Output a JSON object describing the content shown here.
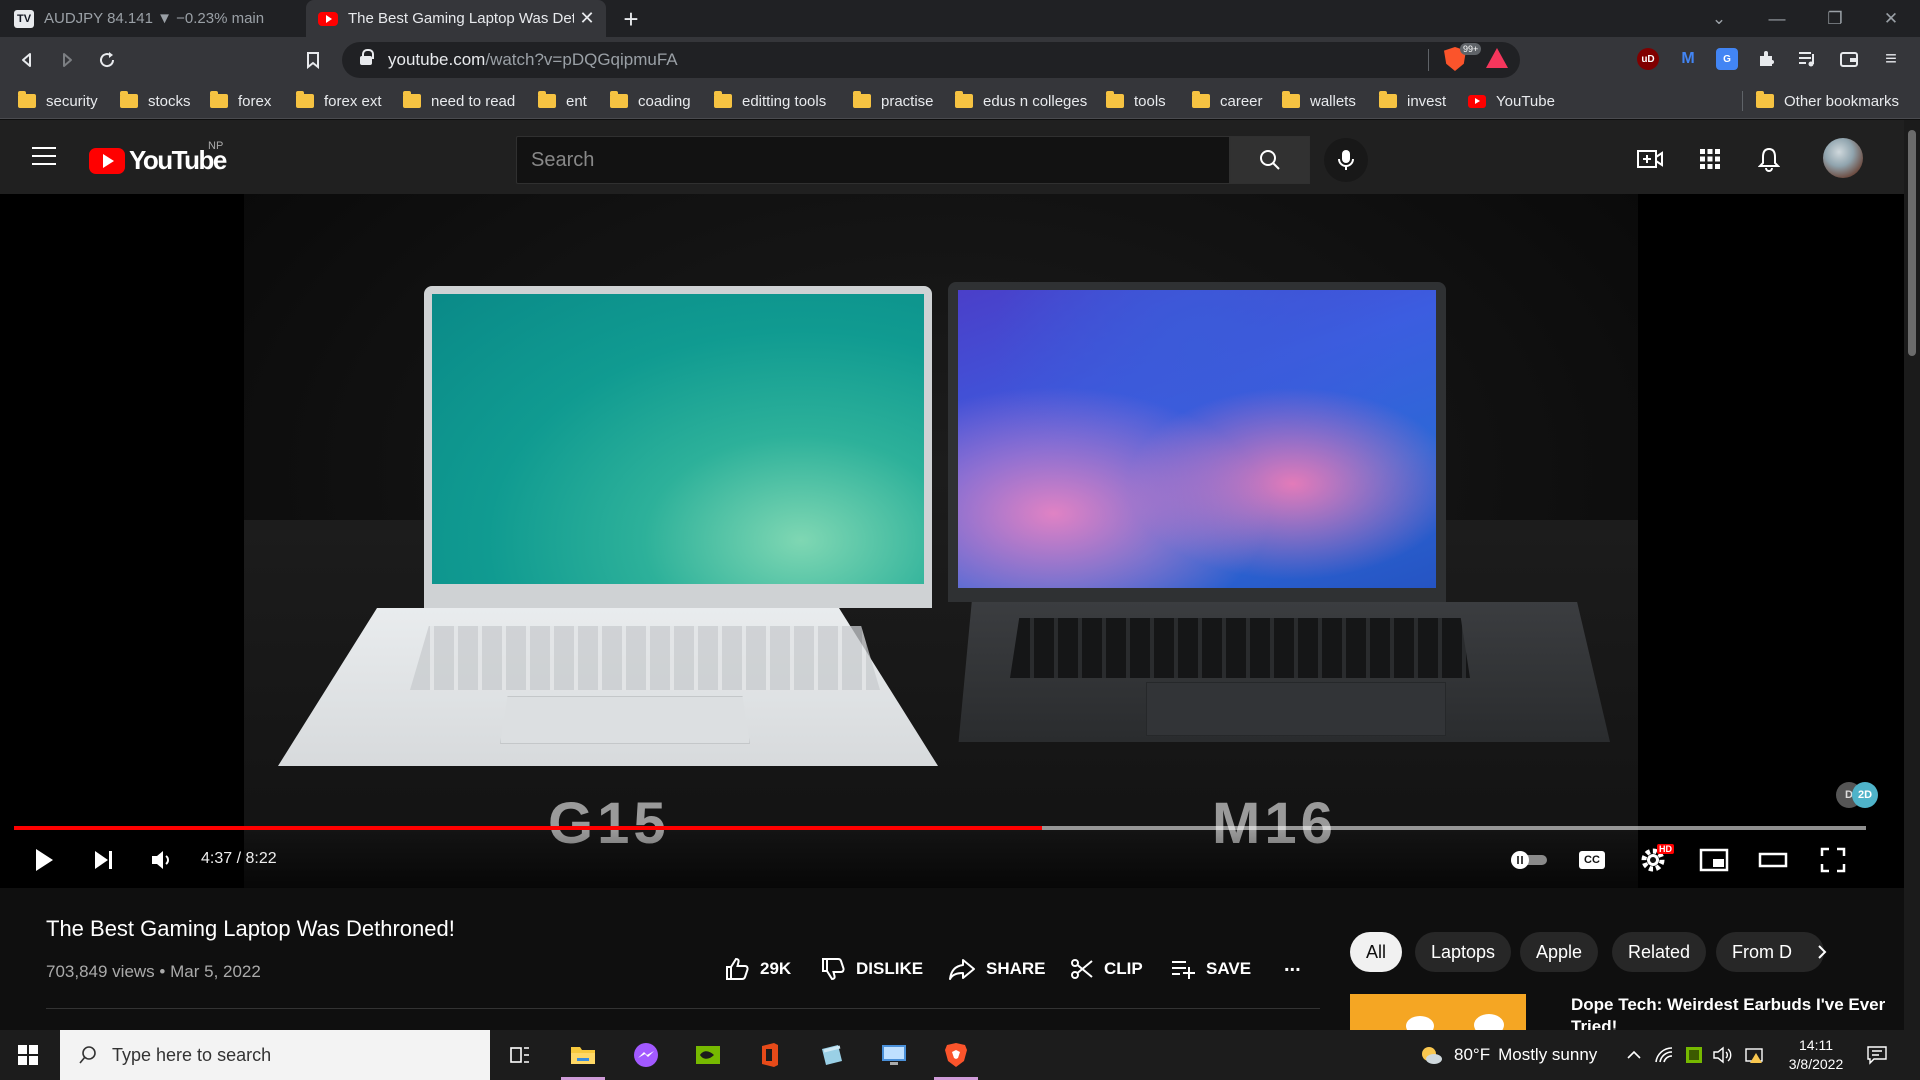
{
  "browser": {
    "tabs": [
      {
        "favicon": "tradingview-icon",
        "title": "AUDJPY 84.141 ▼ −0.23% main",
        "active": false
      },
      {
        "favicon": "youtube-icon",
        "title": "The Best Gaming Laptop Was Det",
        "active": true
      }
    ],
    "url_host": "youtube.com",
    "url_path": "/watch?v=pDQGqipmuFA",
    "shield_badge": "99+",
    "bookmarks": [
      "security",
      "stocks",
      "forex",
      "forex ext",
      "need to read",
      "ent",
      "coading",
      "editting tools",
      "practise",
      "edus n colleges",
      "tools",
      "career",
      "wallets",
      "invest",
      "YouTube"
    ],
    "other_bookmarks": "Other bookmarks"
  },
  "youtube": {
    "logo_text": "YouTube",
    "country_code": "NP",
    "search_placeholder": "Search"
  },
  "player": {
    "overlay_left": "G15",
    "overlay_right": "M16",
    "watermark": {
      "left": "D",
      "right": "2D"
    },
    "time_display": "4:37 / 8:22",
    "progress_played_fraction": 0.555,
    "progress_loaded_fraction": 1.0,
    "hd_badge": "HD",
    "cc_label": "CC"
  },
  "video": {
    "title": "The Best Gaming Laptop Was Dethroned!",
    "views": "703,849 views",
    "separator": "•",
    "date": "Mar 5, 2022",
    "like_count": "29K",
    "dislike_label": "DISLIKE",
    "share_label": "SHARE",
    "clip_label": "CLIP",
    "save_label": "SAVE",
    "more_label": "..."
  },
  "chips": [
    "All",
    "Laptops",
    "Apple",
    "Related",
    "From D"
  ],
  "recommendation": {
    "title": "Dope Tech: Weirdest Earbuds I've Ever Tried!"
  },
  "taskbar": {
    "search_placeholder": "Type here to search",
    "weather_temp": "80°F",
    "weather_desc": "Mostly sunny",
    "time": "14:11",
    "date": "3/8/2022"
  },
  "colors": {
    "yt_red": "#ff0000",
    "browser_dark": "#202124",
    "browser_toolbar": "#35363a",
    "yt_header": "#202020",
    "folder_yellow": "#f6c342"
  }
}
